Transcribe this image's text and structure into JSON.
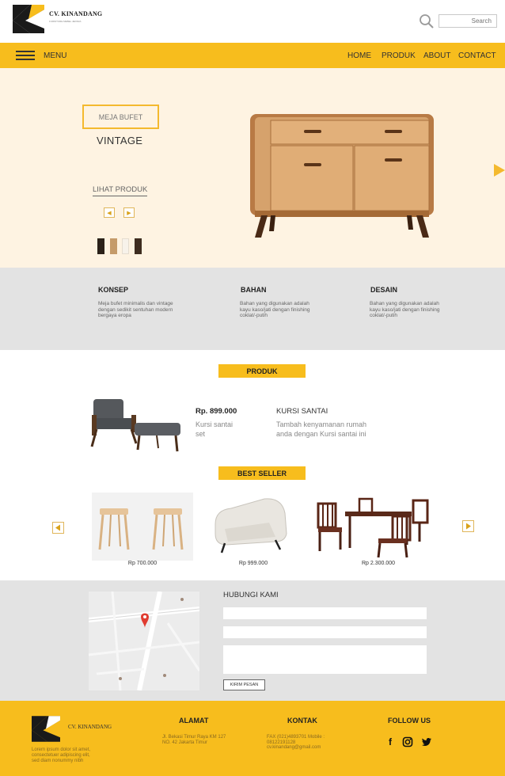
{
  "brand": {
    "name": "CV. KINANDANG",
    "subtitle": "FURNITURE MEBEL JEPARA"
  },
  "search": {
    "placeholder": "Search"
  },
  "nav": {
    "menu_label": "MENU",
    "links": [
      "HOME",
      "PRODUK",
      "ABOUT",
      "CONTACT"
    ]
  },
  "hero": {
    "tag": "MEJA BUFET",
    "title": "VINTAGE",
    "link": "LIHAT PRODUK",
    "prev_icon": "chevron-left-icon",
    "next_icon": "chevron-right-icon",
    "swatches": [
      "#2b2119",
      "#c59b6a",
      "#f7f2ea",
      "#3e2c1f"
    ]
  },
  "features": [
    {
      "title": "KONSEP",
      "text": "Meja bufet minimalis dan vintage dengan sedikit sentuhan modern bergaya eropa"
    },
    {
      "title": "BAHAN",
      "text": "Bahan yang digunakan adalah kayu kaso/jati dengan finishing coklat/-putih"
    },
    {
      "title": "DESAIN",
      "text": "Bahan yang digunakan adalah kayu kaso/jati dengan finishing coklat/-putih"
    }
  ],
  "produk": {
    "tag": "PRODUK",
    "price": "Rp. 899.000",
    "desc": "Kursi santai set",
    "name": "KURSI SANTAI",
    "tagline": "Tambah kenyamanan rumah anda dengan Kursi santai ini"
  },
  "bestseller": {
    "tag": "BEST SELLER",
    "items": [
      {
        "price": "Rp 700.000"
      },
      {
        "price": "Rp 999.000"
      },
      {
        "price": "Rp 2.300.000"
      }
    ]
  },
  "contact": {
    "title": "HUBUNGI KAMI",
    "submit": "KIRIM PESAN"
  },
  "footer": {
    "brand": "CV. KINANDANG",
    "about": "Lorem ipsum dolor sit amet, consectetuer adipiscing elit, sed diam nonummy nibh",
    "alamat_title": "ALAMAT",
    "alamat": "Jl. Bekasi Timur Raya KM 127 NO. 42 Jakarta Timur",
    "kontak_title": "KONTAK",
    "kontak": "FAX (021)4893701 Mobile : 08122191128 cv.kinandang@gmail.com",
    "follow_title": "FOLLOW US",
    "social_icons": [
      "facebook-icon",
      "instagram-icon",
      "twitter-icon"
    ]
  },
  "colors": {
    "accent": "#f7bd1d",
    "hero_bg": "#fef3e2",
    "panel_bg": "#e3e3e3"
  }
}
